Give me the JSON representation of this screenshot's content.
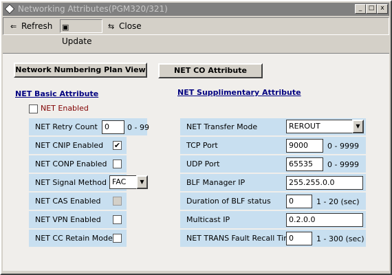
{
  "window": {
    "title": "Networking Attributes(PGM320/321)",
    "min": "_",
    "max": "□",
    "close": "x"
  },
  "toolbar": {
    "refresh": "Refresh",
    "update": "Update",
    "close": "Close"
  },
  "buttons": {
    "numbering_plan": "Network Numbering Plan View",
    "co_attribute": "NET CO Attribute"
  },
  "basic": {
    "title": "NET Basic Attribute",
    "net_enabled": "NET Enabled",
    "rows": [
      {
        "label": "NET Retry Count",
        "value": "0",
        "range": "0 - 99"
      },
      {
        "label": "NET CNIP Enabled",
        "checked": true
      },
      {
        "label": "NET CONP Enabled",
        "checked": false
      },
      {
        "label": "NET Signal Method",
        "value": "FAC"
      },
      {
        "label": "NET CAS Enabled",
        "checked": false,
        "disabled": true
      },
      {
        "label": "NET VPN Enabled",
        "checked": false
      },
      {
        "label": "NET CC Retain Mode",
        "checked": false
      }
    ]
  },
  "supp": {
    "title": "NET Supplimentary Attribute",
    "rows": [
      {
        "label": "NET Transfer Mode",
        "value": "REROUT"
      },
      {
        "label": "TCP Port",
        "value": "9000",
        "range": "0 - 9999"
      },
      {
        "label": "UDP Port",
        "value": "65535",
        "range": "0 - 9999"
      },
      {
        "label": "BLF Manager IP",
        "value": "255.255.0.0"
      },
      {
        "label": "Duration of BLF status",
        "value": "0",
        "range": "1 - 20 (sec)"
      },
      {
        "label": "Multicast IP",
        "value": "0.2.0.0"
      },
      {
        "label": "NET TRANS Fault Recall Timer",
        "value": "0",
        "range": "1 - 300 (sec)"
      }
    ]
  }
}
